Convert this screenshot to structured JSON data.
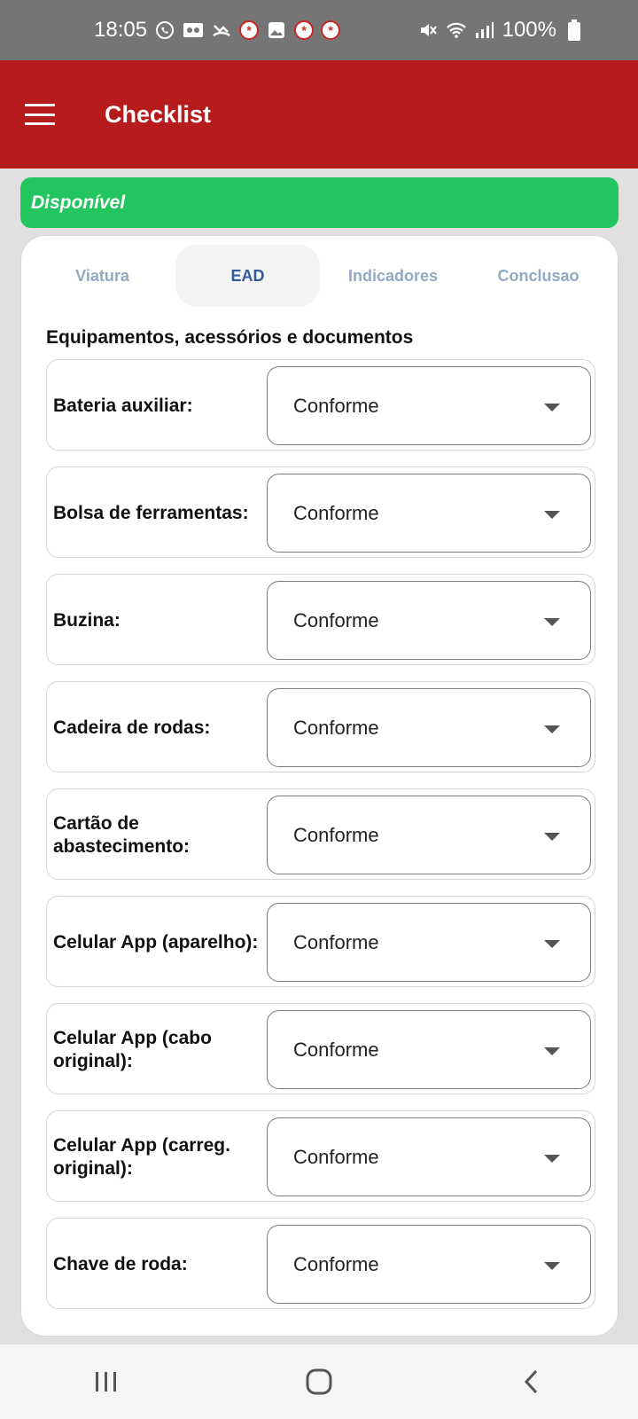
{
  "status_bar": {
    "time": "18:05",
    "battery": "100%"
  },
  "app_bar": {
    "title": "Checklist"
  },
  "banner": {
    "text": "Disponível",
    "color": "#22c55e"
  },
  "tabs": [
    {
      "label": "Viatura",
      "active": false
    },
    {
      "label": "EAD",
      "active": true
    },
    {
      "label": "Indicadores",
      "active": false
    },
    {
      "label": "Conclusao",
      "active": false
    }
  ],
  "section": {
    "title": "Equipamentos, acessórios e documentos"
  },
  "items": [
    {
      "label": "Bateria auxiliar:",
      "value": "Conforme"
    },
    {
      "label": "Bolsa de ferramentas:",
      "value": "Conforme"
    },
    {
      "label": "Buzina:",
      "value": "Conforme"
    },
    {
      "label": "Cadeira de rodas:",
      "value": "Conforme"
    },
    {
      "label": "Cartão de abastecimento:",
      "value": "Conforme"
    },
    {
      "label": "Celular App (aparelho):",
      "value": "Conforme"
    },
    {
      "label": "Celular App (cabo original):",
      "value": "Conforme"
    },
    {
      "label": "Celular App (carreg. original):",
      "value": "Conforme"
    },
    {
      "label": "Chave de roda:",
      "value": "Conforme"
    }
  ],
  "colors": {
    "app_bar": "#b71c1c",
    "active_tab_text": "#2f5a9e",
    "inactive_tab_text": "#94a8c2"
  }
}
